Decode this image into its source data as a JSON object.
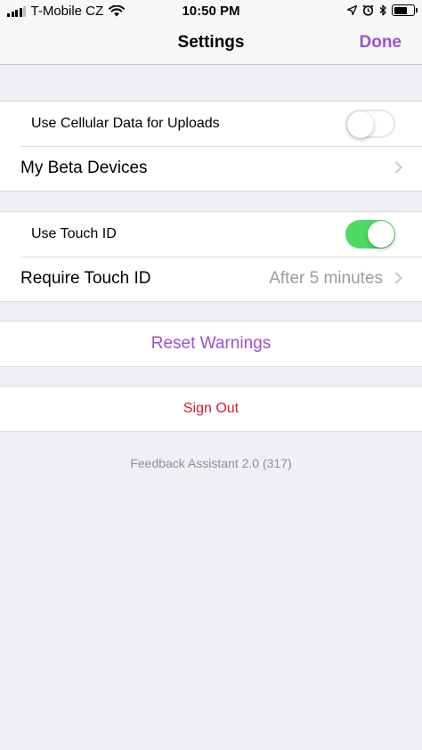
{
  "status_bar": {
    "carrier": "T-Mobile CZ",
    "time": "10:50 PM"
  },
  "nav": {
    "title": "Settings",
    "done_label": "Done"
  },
  "sections": {
    "uploads": {
      "cellular_label": "Use Cellular Data for Uploads",
      "cellular_enabled": false,
      "beta_devices_label": "My Beta Devices"
    },
    "security": {
      "touch_id_label": "Use Touch ID",
      "touch_id_enabled": true,
      "require_label": "Require Touch ID",
      "require_value": "After 5 minutes"
    },
    "warnings": {
      "reset_label": "Reset Warnings"
    },
    "account": {
      "sign_out_label": "Sign Out"
    }
  },
  "footer": {
    "version": "Feedback Assistant 2.0 (317)"
  },
  "colors": {
    "accent": "#9b4fd6",
    "destructive": "#cc1e2e",
    "toggle_on": "#4cd964",
    "background": "#efeff4"
  }
}
